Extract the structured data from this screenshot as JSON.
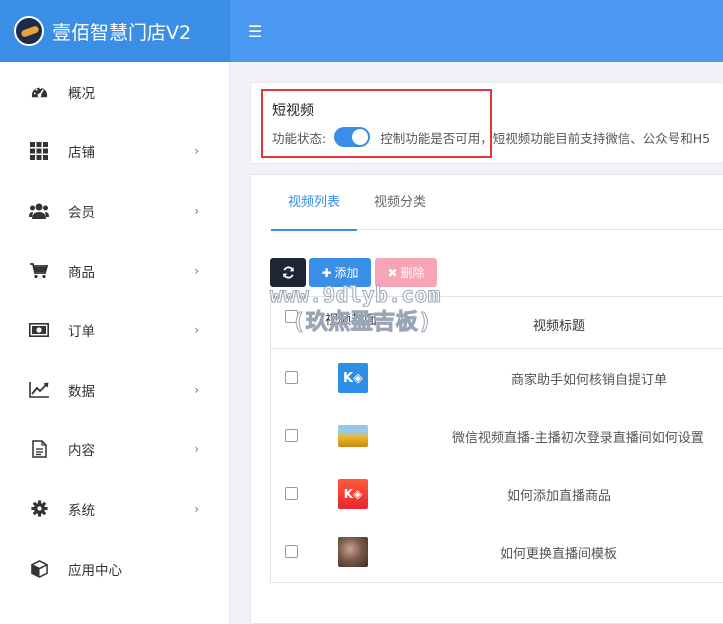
{
  "app": {
    "title": "壹佰智慧门店V2"
  },
  "sidebar": {
    "items": [
      {
        "label": "概况",
        "icon": "dashboard-icon",
        "has_arrow": false
      },
      {
        "label": "店铺",
        "icon": "grid-icon",
        "has_arrow": true
      },
      {
        "label": "会员",
        "icon": "users-icon",
        "has_arrow": true
      },
      {
        "label": "商品",
        "icon": "cart-icon",
        "has_arrow": true
      },
      {
        "label": "订单",
        "icon": "money-icon",
        "has_arrow": true
      },
      {
        "label": "数据",
        "icon": "chart-icon",
        "has_arrow": true
      },
      {
        "label": "内容",
        "icon": "document-icon",
        "has_arrow": true
      },
      {
        "label": "系统",
        "icon": "gear-icon",
        "has_arrow": true
      },
      {
        "label": "应用中心",
        "icon": "cube-icon",
        "has_arrow": false
      }
    ]
  },
  "feature": {
    "title": "短视频",
    "status_label": "功能状态:",
    "enabled": true,
    "description": "控制功能是否可用，短视频功能目前支持微信、公众号和H5"
  },
  "tabs": [
    {
      "label": "视频列表",
      "active": true
    },
    {
      "label": "视频分类",
      "active": false
    }
  ],
  "toolbar": {
    "add_label": "添加",
    "delete_label": "删除"
  },
  "watermark": {
    "line1": "www.9dlyb.com",
    "line2": "(玖点盈吉板)"
  },
  "table": {
    "headers": {
      "cover": "视频封面",
      "title": "视频标题"
    },
    "rows": [
      {
        "cover": "kd-logo-blue",
        "title": "商家助手如何核销自提订单"
      },
      {
        "cover": "yellow-flowers-photo",
        "title": "微信视频直播-主播初次登录直播间如何设置"
      },
      {
        "cover": "kd-logo-red",
        "title": "如何添加直播商品"
      },
      {
        "cover": "portrait-photo",
        "title": "如何更换直播间模板"
      }
    ]
  },
  "colors": {
    "brand": "#3a8ee6",
    "topbar": "#4a98f0",
    "delete": "#f7a4b6",
    "highlight": "#e53535"
  }
}
